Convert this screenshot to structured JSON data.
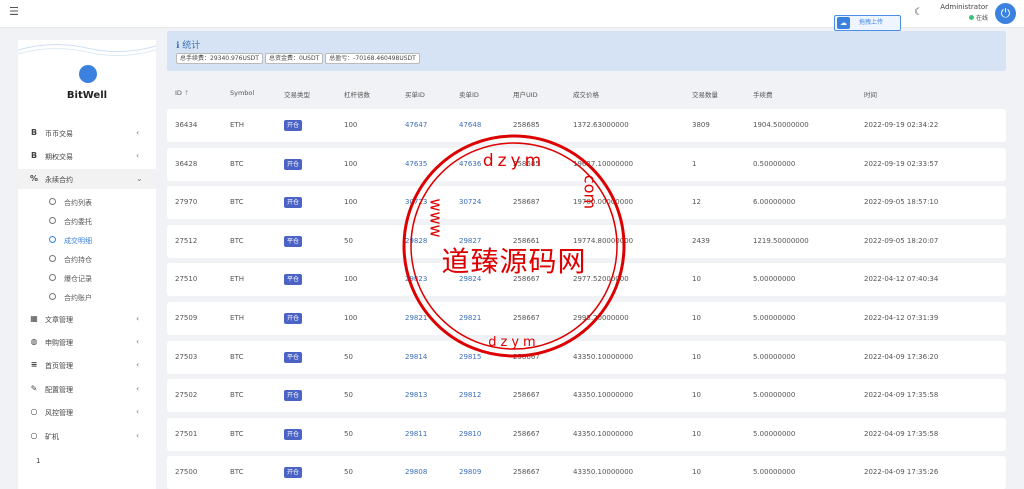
{
  "topbar": {
    "menu_icon": "menu-icon",
    "upload_label": "拖拽上传",
    "theme_icon": "moon-icon",
    "user_name": "Administrator",
    "user_status": "在线",
    "power_icon": "power-icon"
  },
  "sidebar": {
    "brand": "BitWell",
    "items": [
      {
        "icon": "B",
        "label": "币币交易"
      },
      {
        "icon": "B",
        "label": "期权交易"
      },
      {
        "icon": "%",
        "label": "永续合约"
      },
      {
        "icon": "▦",
        "label": "文章管理"
      },
      {
        "icon": "◍",
        "label": "申购管理"
      },
      {
        "icon": "≡",
        "label": "首页管理"
      },
      {
        "icon": "✎",
        "label": "配置管理"
      },
      {
        "icon": "○",
        "label": "风控管理"
      },
      {
        "icon": "○",
        "label": "矿机"
      }
    ],
    "subitems": [
      "合约列表",
      "合约委托",
      "成交明细",
      "合约持仓",
      "爆仓记录",
      "合约账户"
    ],
    "active_sub": "成交明细",
    "page": "1"
  },
  "stats": {
    "title": "统计",
    "chips": [
      "总手续费：29340.976USDT",
      "总资金费：0USDT",
      "总盈亏：-70168.460498USDT"
    ]
  },
  "table": {
    "headers": [
      "ID",
      "Symbol",
      "交易类型",
      "杠杆倍数",
      "买单ID",
      "卖单ID",
      "用户UID",
      "成交价格",
      "交易数量",
      "手续费",
      "时间"
    ],
    "rows": [
      {
        "id": "36434",
        "symbol": "ETH",
        "type": "开仓",
        "lev": "100",
        "buy": "47647",
        "sell": "47648",
        "uid": "258685",
        "price": "1372.63000000",
        "qty": "3809",
        "fee": "1904.50000000",
        "time": "2022-09-19 02:34:22"
      },
      {
        "id": "36428",
        "symbol": "BTC",
        "type": "开仓",
        "lev": "100",
        "buy": "47635",
        "sell": "47636",
        "uid": "258685",
        "price": "19627.10000000",
        "qty": "1",
        "fee": "0.50000000",
        "time": "2022-09-19 02:33:57"
      },
      {
        "id": "27970",
        "symbol": "BTC",
        "type": "开仓",
        "lev": "100",
        "buy": "30723",
        "sell": "30724",
        "uid": "258687",
        "price": "19700.00000000",
        "qty": "12",
        "fee": "6.00000000",
        "time": "2022-09-05 18:57:10"
      },
      {
        "id": "27512",
        "symbol": "BTC",
        "type": "平仓",
        "lev": "50",
        "buy": "29828",
        "sell": "29827",
        "uid": "258661",
        "price": "19774.80000000",
        "qty": "2439",
        "fee": "1219.50000000",
        "time": "2022-09-05 18:20:07"
      },
      {
        "id": "27510",
        "symbol": "ETH",
        "type": "平仓",
        "lev": "100",
        "buy": "29823",
        "sell": "29824",
        "uid": "258667",
        "price": "2977.52000000",
        "qty": "10",
        "fee": "5.00000000",
        "time": "2022-04-12 07:40:34"
      },
      {
        "id": "27509",
        "symbol": "ETH",
        "type": "开仓",
        "lev": "100",
        "buy": "29821",
        "sell": "29821",
        "uid": "258667",
        "price": "2995.20000000",
        "qty": "10",
        "fee": "5.00000000",
        "time": "2022-04-12 07:31:39"
      },
      {
        "id": "27503",
        "symbol": "BTC",
        "type": "平仓",
        "lev": "50",
        "buy": "29814",
        "sell": "29815",
        "uid": "258667",
        "price": "43350.10000000",
        "qty": "10",
        "fee": "5.00000000",
        "time": "2022-04-09 17:36:20"
      },
      {
        "id": "27502",
        "symbol": "BTC",
        "type": "开仓",
        "lev": "50",
        "buy": "29813",
        "sell": "29812",
        "uid": "258667",
        "price": "43350.10000000",
        "qty": "10",
        "fee": "5.00000000",
        "time": "2022-04-09 17:35:58"
      },
      {
        "id": "27501",
        "symbol": "BTC",
        "type": "开仓",
        "lev": "50",
        "buy": "29811",
        "sell": "29810",
        "uid": "258667",
        "price": "43350.10000000",
        "qty": "10",
        "fee": "5.00000000",
        "time": "2022-04-09 17:35:58"
      },
      {
        "id": "27500",
        "symbol": "BTC",
        "type": "开仓",
        "lev": "50",
        "buy": "29808",
        "sell": "29809",
        "uid": "258667",
        "price": "43350.10000000",
        "qty": "10",
        "fee": "5.00000000",
        "time": "2022-04-09 17:35:26"
      }
    ]
  },
  "watermark": {
    "center_text": "道臻源码网",
    "top_text": "dzym",
    "left_text": "www",
    "right_text": "com",
    "bottom_text": "dzym"
  },
  "colors": {
    "badge": "#4a63c4",
    "accent": "#3b82e0",
    "link": "#3b6fb8",
    "watermark": "#dd0000"
  }
}
